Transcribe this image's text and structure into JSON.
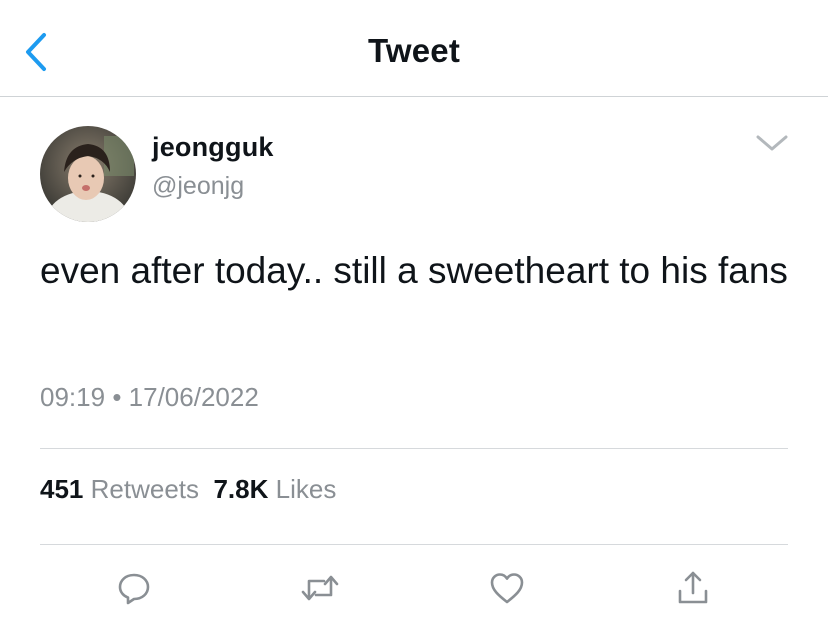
{
  "header": {
    "title": "Tweet",
    "back_icon": "chevron-left-icon"
  },
  "author": {
    "display_name": "jeongguk",
    "handle": "@jeonjg"
  },
  "tweet": {
    "text": "even after today.. still a sweetheart to his fans",
    "time": "09:19",
    "separator": "•",
    "date": "17/06/2022"
  },
  "stats": {
    "retweets_count": "451",
    "retweets_label": "Retweets",
    "likes_count": "7.8K",
    "likes_label": "Likes"
  },
  "actions": [
    "reply-icon",
    "retweet-icon",
    "like-icon",
    "share-icon"
  ],
  "colors": {
    "accent": "#1d9bf0",
    "text": "#0f1419",
    "secondary_text": "#8a8f94",
    "divider": "#d6d9dc",
    "icon": "#8a8f94"
  }
}
